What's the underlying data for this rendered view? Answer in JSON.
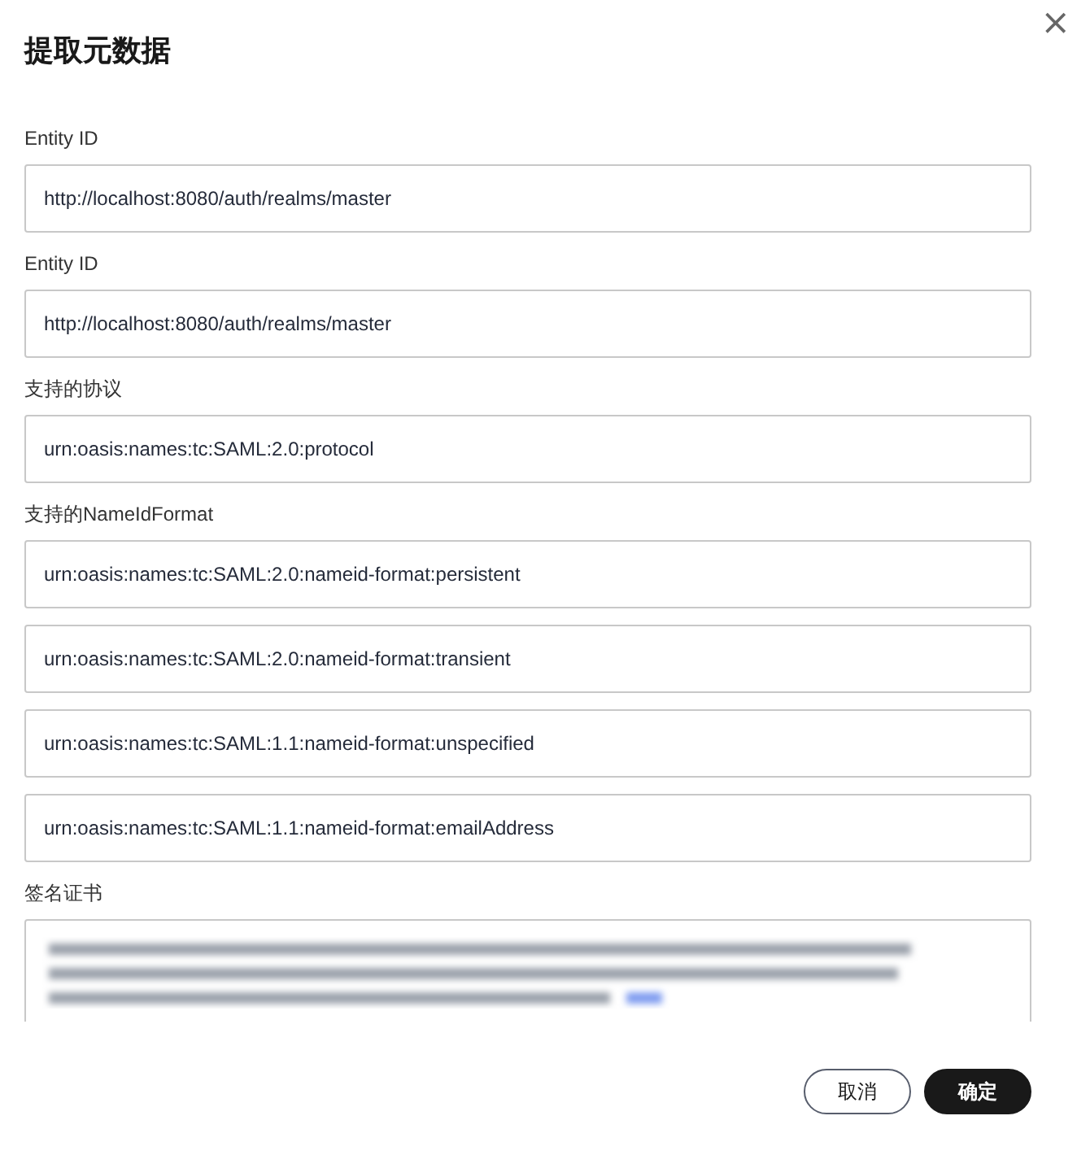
{
  "dialog": {
    "title": "提取元数据",
    "close": "×"
  },
  "sections": [
    {
      "label": "Entity ID",
      "values": [
        "http://localhost:8080/auth/realms/master"
      ]
    },
    {
      "label": "Entity ID",
      "values": [
        "http://localhost:8080/auth/realms/master"
      ]
    },
    {
      "label": "支持的协议",
      "values": [
        "urn:oasis:names:tc:SAML:2.0:protocol"
      ]
    },
    {
      "label": "支持的NameIdFormat",
      "values": [
        "urn:oasis:names:tc:SAML:2.0:nameid-format:persistent",
        "urn:oasis:names:tc:SAML:2.0:nameid-format:transient",
        "urn:oasis:names:tc:SAML:1.1:nameid-format:unspecified",
        "urn:oasis:names:tc:SAML:1.1:nameid-format:emailAddress"
      ]
    }
  ],
  "certificate": {
    "label": "签名证书",
    "kind": "blurred"
  },
  "buttons": [
    {
      "label": "取消",
      "kind": "secondary"
    },
    {
      "label": "确定",
      "kind": "primary"
    }
  ]
}
